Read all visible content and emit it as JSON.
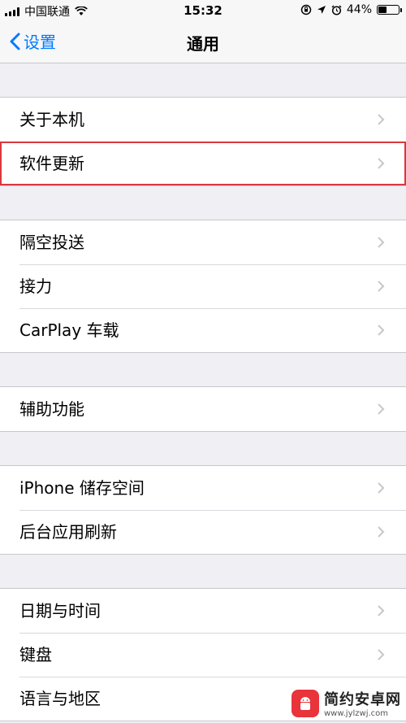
{
  "status_bar": {
    "carrier": "中国联通",
    "time": "15:32",
    "battery_percent_label": "44%",
    "battery_level": 0.44,
    "icons": [
      "signal-icon",
      "wifi-icon",
      "rotation-lock-icon",
      "location-icon",
      "alarm-icon",
      "battery-icon"
    ]
  },
  "nav": {
    "back_label": "设置",
    "title": "通用",
    "back_icon": "chevron-left-icon"
  },
  "groups": [
    {
      "rows": [
        {
          "label": "关于本机"
        },
        {
          "label": "软件更新",
          "highlighted": true
        }
      ]
    },
    {
      "rows": [
        {
          "label": "隔空投送"
        },
        {
          "label": "接力"
        },
        {
          "label": "CarPlay 车载"
        }
      ]
    },
    {
      "rows": [
        {
          "label": "辅助功能"
        }
      ]
    },
    {
      "rows": [
        {
          "label": "iPhone 储存空间"
        },
        {
          "label": "后台应用刷新"
        }
      ]
    },
    {
      "rows": [
        {
          "label": "日期与时间"
        },
        {
          "label": "键盘"
        },
        {
          "label": "语言与地区"
        }
      ]
    }
  ],
  "colors": {
    "accent": "#007aff",
    "highlight_border": "#d9393e",
    "background": "#efeff4",
    "chevron": "#c7c7cc"
  },
  "watermark": {
    "name": "简约安卓网",
    "url": "www.jylzwj.com"
  }
}
